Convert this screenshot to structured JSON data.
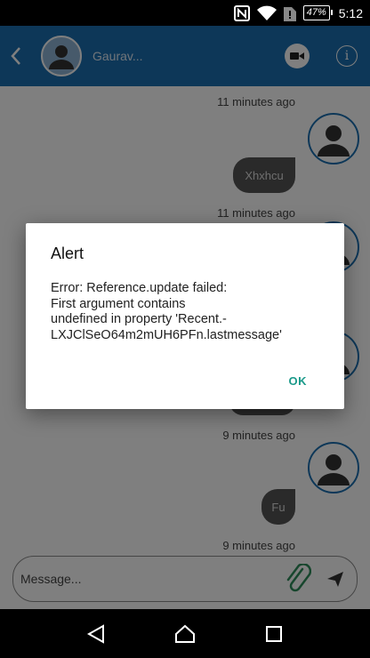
{
  "status_bar": {
    "battery": "47%",
    "time": "5:12"
  },
  "header": {
    "contact_name": "Gaurav...",
    "info_label": "i"
  },
  "messages": [
    {
      "timestamp": "11 minutes ago",
      "text": ""
    },
    {
      "timestamp": "",
      "text": "Xhxhcu"
    },
    {
      "timestamp": "11 minutes ago",
      "text": ""
    },
    {
      "timestamp": "9 minutes ago",
      "text": ""
    },
    {
      "timestamp": "",
      "text": "Fu"
    },
    {
      "timestamp": "9 minutes ago",
      "text": ""
    }
  ],
  "composer": {
    "placeholder": "Message..."
  },
  "dialog": {
    "title": "Alert",
    "message": "Error: Reference.update failed:\nFirst argument contains\nundefined in property 'Recent.-\nLXJClSeO64m2mUH6PFn.lastmessage'",
    "ok_label": "OK"
  },
  "colors": {
    "app_bar": "#1a6fb0",
    "accent": "#1b9a8a",
    "bubble": "#555555"
  }
}
